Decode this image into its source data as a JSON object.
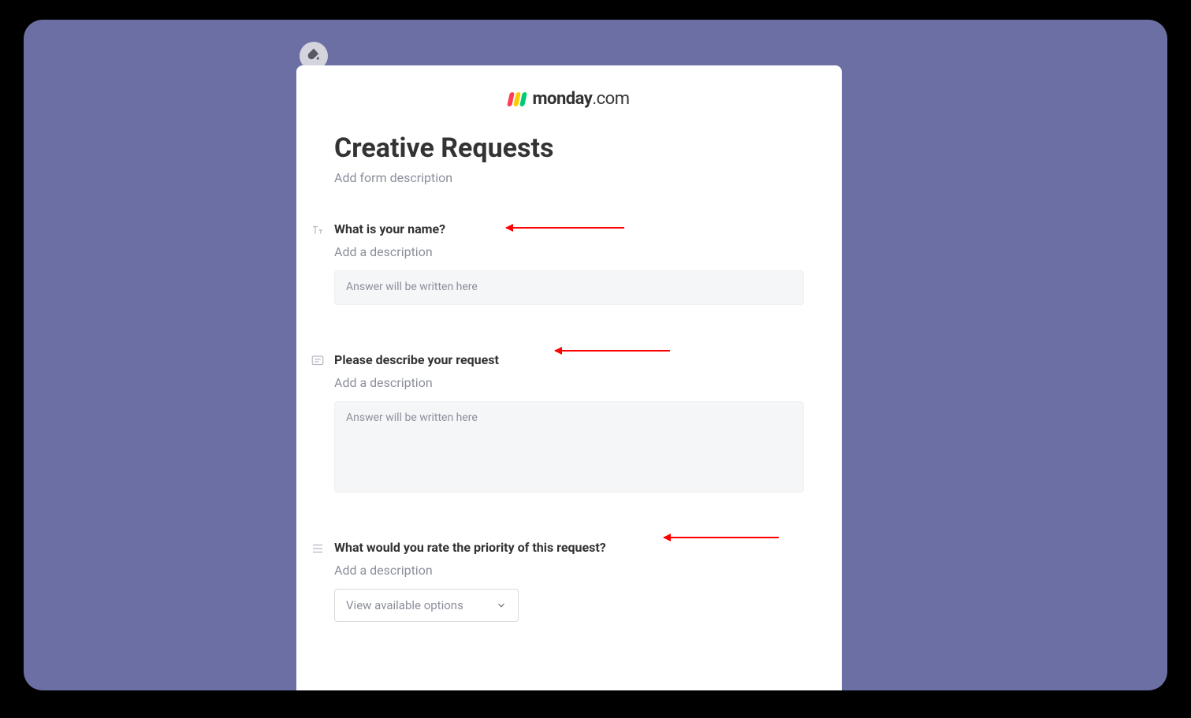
{
  "logo": {
    "brand": "monday",
    "suffix": ".com"
  },
  "form": {
    "title": "Creative Requests",
    "description_placeholder": "Add form description"
  },
  "questions": [
    {
      "icon": "text-type-icon",
      "title": "What is your name?",
      "description_placeholder": "Add a description",
      "answer_placeholder": "Answer will be written here",
      "type": "short_text"
    },
    {
      "icon": "long-text-icon",
      "title": "Please describe your request",
      "description_placeholder": "Add a description",
      "answer_placeholder": "Answer will be written here",
      "type": "long_text"
    },
    {
      "icon": "list-icon",
      "title": "What would you rate the priority of this request?",
      "description_placeholder": "Add a description",
      "select_placeholder": "View available options",
      "type": "select"
    }
  ],
  "theme_color": "#6b6fa3",
  "annotation": "red arrows pointing to each question title"
}
